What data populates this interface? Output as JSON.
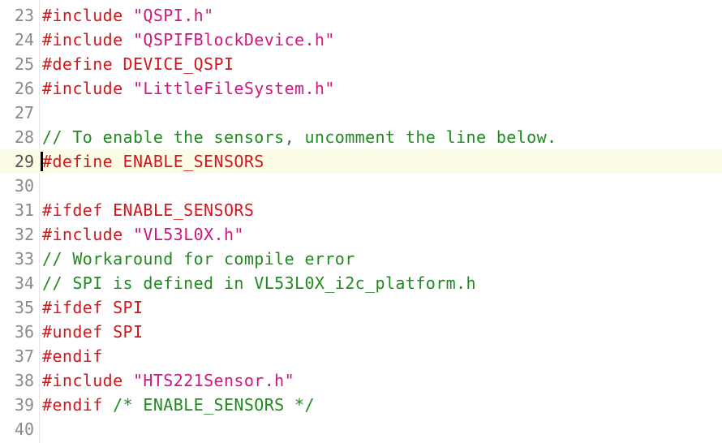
{
  "editor": {
    "colors": {
      "directive": "#d4161c",
      "string": "#d1177e",
      "comment": "#1d8b1d",
      "line_number": "#8b8b8b",
      "active_line_bg": "#fcfce7"
    },
    "active_line": "29",
    "lines": [
      {
        "num": "23",
        "tokens": [
          {
            "type": "directive",
            "text": "#include "
          },
          {
            "type": "string",
            "text": "\"QSPI.h\""
          }
        ]
      },
      {
        "num": "24",
        "tokens": [
          {
            "type": "directive",
            "text": "#include "
          },
          {
            "type": "string",
            "text": "\"QSPIFBlockDevice.h\""
          }
        ]
      },
      {
        "num": "25",
        "tokens": [
          {
            "type": "directive",
            "text": "#define DEVICE_QSPI"
          }
        ]
      },
      {
        "num": "26",
        "tokens": [
          {
            "type": "directive",
            "text": "#include "
          },
          {
            "type": "string",
            "text": "\"LittleFileSystem.h\""
          }
        ]
      },
      {
        "num": "27",
        "tokens": []
      },
      {
        "num": "28",
        "tokens": [
          {
            "type": "comment",
            "text": "// To enable the sensors, uncomment the line below."
          }
        ]
      },
      {
        "num": "29",
        "tokens": [
          {
            "type": "directive",
            "text": "#define ENABLE_SENSORS"
          }
        ]
      },
      {
        "num": "30",
        "tokens": []
      },
      {
        "num": "31",
        "tokens": [
          {
            "type": "directive",
            "text": "#ifdef ENABLE_SENSORS"
          }
        ]
      },
      {
        "num": "32",
        "tokens": [
          {
            "type": "directive",
            "text": "#include "
          },
          {
            "type": "string",
            "text": "\"VL53L0X.h\""
          }
        ]
      },
      {
        "num": "33",
        "tokens": [
          {
            "type": "comment",
            "text": "// Workaround for compile error"
          }
        ]
      },
      {
        "num": "34",
        "tokens": [
          {
            "type": "comment",
            "text": "// SPI is defined in VL53L0X_i2c_platform.h"
          }
        ]
      },
      {
        "num": "35",
        "tokens": [
          {
            "type": "directive",
            "text": "#ifdef SPI"
          }
        ]
      },
      {
        "num": "36",
        "tokens": [
          {
            "type": "directive",
            "text": "#undef SPI"
          }
        ]
      },
      {
        "num": "37",
        "tokens": [
          {
            "type": "directive",
            "text": "#endif"
          }
        ]
      },
      {
        "num": "38",
        "tokens": [
          {
            "type": "directive",
            "text": "#include "
          },
          {
            "type": "string",
            "text": "\"HTS221Sensor.h\""
          }
        ]
      },
      {
        "num": "39",
        "tokens": [
          {
            "type": "directive",
            "text": "#endif "
          },
          {
            "type": "comment",
            "text": "/* ENABLE_SENSORS */"
          }
        ]
      },
      {
        "num": "40",
        "tokens": []
      }
    ]
  }
}
